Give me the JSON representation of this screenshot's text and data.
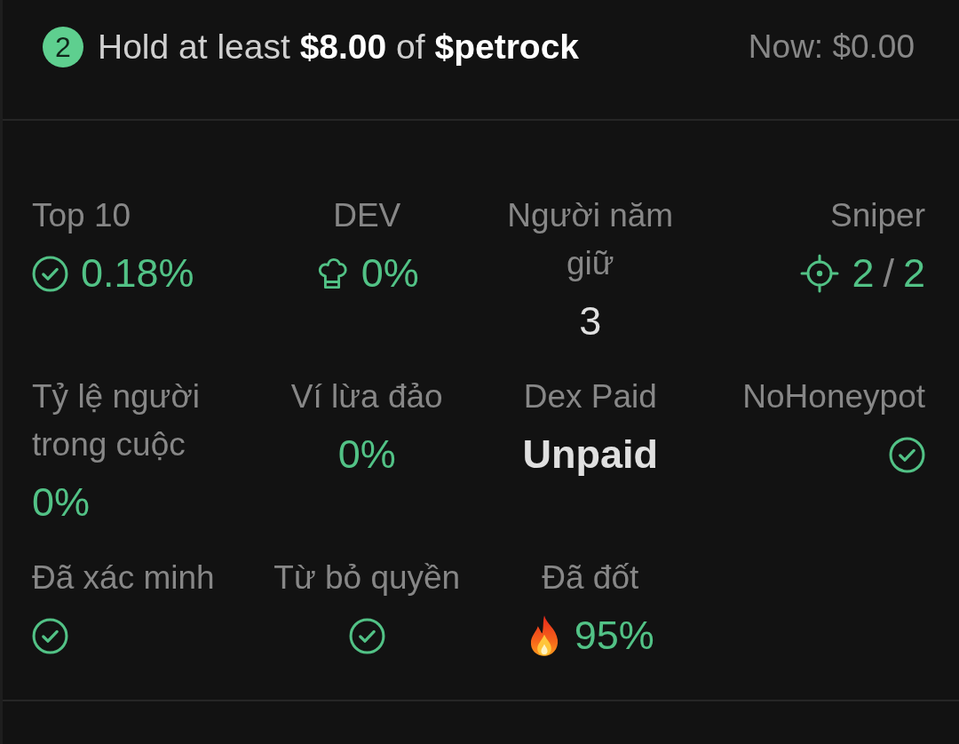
{
  "task": {
    "number": "2",
    "text": "Hold at least **$8.00** of **$petrock**",
    "now": "Now: $0.00"
  },
  "stats": [
    {
      "label": "Top 10",
      "kind": "check-value",
      "value": "0.18%"
    },
    {
      "label": "DEV",
      "kind": "dev-value",
      "value": "0%"
    },
    {
      "label": "Người năm giữ",
      "kind": "count",
      "value": "3"
    },
    {
      "label": "Sniper",
      "kind": "ratio",
      "value": "2",
      "separator": "/",
      "total": "2"
    },
    {
      "label": "Tỷ lệ người trong cuộc",
      "kind": "percent",
      "value": "0%"
    },
    {
      "label": "Ví lừa đảo",
      "kind": "percent",
      "value": "0%"
    },
    {
      "label": "Dex Paid",
      "kind": "status",
      "value": "Unpaid"
    },
    {
      "label": "NoHoneypot",
      "kind": "check"
    },
    {
      "label": "Đã xác minh",
      "kind": "check"
    },
    {
      "label": "Từ bỏ quyền",
      "kind": "check"
    },
    {
      "label": "Đã đốt",
      "kind": "burnt",
      "value": "95%"
    }
  ]
}
